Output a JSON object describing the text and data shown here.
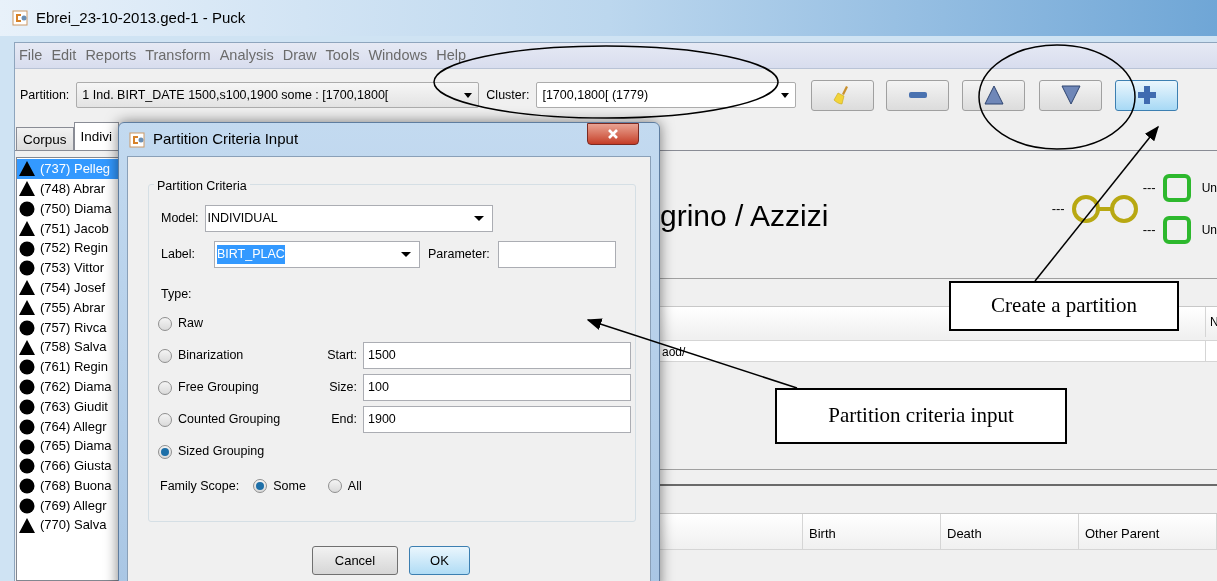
{
  "window": {
    "title": "Ebrei_23-10-2013.ged-1 - Puck"
  },
  "menu": [
    "File",
    "Edit",
    "Reports",
    "Transform",
    "Analysis",
    "Draw",
    "Tools",
    "Windows",
    "Help"
  ],
  "toolbar": {
    "partition_label": "Partition:",
    "partition_value": "1 Ind. BIRT_DATE 1500,s100,1900 some : [1700,1800[",
    "cluster_label": "Cluster:",
    "cluster_value": "[1700,1800[ (1779)",
    "buttons": [
      {
        "kind": "broom",
        "focused": false
      },
      {
        "kind": "minus",
        "focused": false
      },
      {
        "kind": "up",
        "focused": false
      },
      {
        "kind": "down",
        "focused": false
      },
      {
        "kind": "plus",
        "focused": true
      }
    ]
  },
  "tabs": [
    {
      "label": "Corpus",
      "selected": false
    },
    {
      "label": "Indivi",
      "selected": true
    }
  ],
  "individuals": [
    {
      "label": "(737) Pelleg",
      "kind": "male",
      "selected": true
    },
    {
      "label": "(748) Abrar",
      "kind": "male",
      "selected": false
    },
    {
      "label": "(750) Diama",
      "kind": "female",
      "selected": false
    },
    {
      "label": "(751) Jacob",
      "kind": "male",
      "selected": false
    },
    {
      "label": "(752) Regin",
      "kind": "female",
      "selected": false
    },
    {
      "label": "(753) Vittor",
      "kind": "female",
      "selected": false
    },
    {
      "label": "(754) Josef",
      "kind": "male",
      "selected": false
    },
    {
      "label": "(755) Abrar",
      "kind": "male",
      "selected": false
    },
    {
      "label": "(757) Rivca",
      "kind": "female",
      "selected": false
    },
    {
      "label": "(758) Salva",
      "kind": "male",
      "selected": false
    },
    {
      "label": "(761) Regin",
      "kind": "female",
      "selected": false
    },
    {
      "label": "(762) Diama",
      "kind": "female",
      "selected": false
    },
    {
      "label": "(763) Giudit",
      "kind": "female",
      "selected": false
    },
    {
      "label": "(764) Allegr",
      "kind": "female",
      "selected": false
    },
    {
      "label": "(765) Diama",
      "kind": "female",
      "selected": false
    },
    {
      "label": "(766) Giusta",
      "kind": "female",
      "selected": false
    },
    {
      "label": "(768) Buona",
      "kind": "female",
      "selected": false
    },
    {
      "label": "(769) Allegr",
      "kind": "female",
      "selected": false
    },
    {
      "label": "(770) Salva",
      "kind": "male",
      "selected": false
    }
  ],
  "details": {
    "name": "grino / Azzizi",
    "spouse_dash": "---",
    "parents": [
      {
        "dash": "---",
        "label": "Un"
      },
      {
        "dash": "---",
        "label": "Un"
      }
    ]
  },
  "upper_table": {
    "column_2": "N",
    "cell": "aod/"
  },
  "lower_table": {
    "columns": [
      "Birth",
      "Death",
      "Other Parent"
    ]
  },
  "dialog": {
    "title": "Partition Criteria Input",
    "group_title": "Partition Criteria",
    "model_label": "Model:",
    "model_value": "INDIVIDUAL",
    "label_label": "Label:",
    "label_value": "BIRT_PLAC",
    "label_text_selected": true,
    "parameter_label": "Parameter:",
    "type_label": "Type:",
    "types": [
      {
        "label": "Raw",
        "selected": false
      },
      {
        "label": "Binarization",
        "selected": false
      },
      {
        "label": "Free Grouping",
        "selected": false
      },
      {
        "label": "Counted Grouping",
        "selected": false
      },
      {
        "label": "Sized Grouping",
        "selected": true
      }
    ],
    "range_fields": [
      {
        "label": "Start:",
        "value": "1500"
      },
      {
        "label": "Size:",
        "value": "100"
      },
      {
        "label": "End:",
        "value": "1900"
      }
    ],
    "family_scope_label": "Family Scope:",
    "scopes": [
      {
        "label": "Some",
        "selected": true
      },
      {
        "label": "All",
        "selected": false
      }
    ],
    "buttons": [
      {
        "label": "Cancel",
        "default": false
      },
      {
        "label": "OK",
        "default": true
      }
    ]
  },
  "annotations": [
    {
      "text": "Create a partition"
    },
    {
      "text": "Partition criteria input"
    }
  ]
}
